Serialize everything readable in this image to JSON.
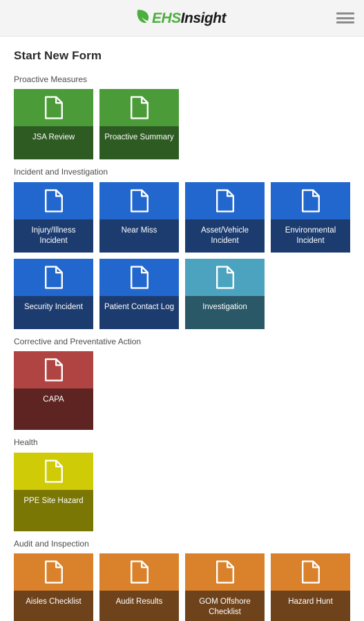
{
  "header": {
    "logo": {
      "leaf_icon": "leaf-icon",
      "brand_primary": "EHS",
      "brand_secondary": "Insight"
    },
    "menu_icon": "hamburger-menu-icon"
  },
  "page": {
    "title": "Start New Form"
  },
  "colors": {
    "header_bg": "#f4f4f4",
    "leaf_green": "#4cae3e",
    "green_light": "#4b9b38",
    "green_dark": "#2d5b22",
    "blue_light": "#2167ce",
    "blue_dark": "#1c3c70",
    "teal_light": "#4ba3bf",
    "teal_dark": "#2a5866",
    "red_light": "#b04442",
    "red_dark": "#5e2422",
    "yellow_light": "#cfcb07",
    "yellow_dark": "#7a7705",
    "orange_light": "#d9822b",
    "orange_dark": "#6e431c"
  },
  "sections": [
    {
      "label": "Proactive Measures",
      "rows": [
        [
          {
            "label": "JSA Review",
            "icon": "document-icon",
            "top_color": "#4b9b38",
            "bottom_color": "#2d5b22"
          },
          {
            "label": "Proactive Summary",
            "icon": "document-icon",
            "top_color": "#4b9b38",
            "bottom_color": "#2d5b22"
          }
        ]
      ]
    },
    {
      "label": "Incident and Investigation",
      "rows": [
        [
          {
            "label": "Injury/Illness Incident",
            "icon": "document-icon",
            "top_color": "#2167ce",
            "bottom_color": "#1c3c70"
          },
          {
            "label": "Near Miss",
            "icon": "document-icon",
            "top_color": "#2167ce",
            "bottom_color": "#1c3c70"
          },
          {
            "label": "Asset/Vehicle Incident",
            "icon": "document-icon",
            "top_color": "#2167ce",
            "bottom_color": "#1c3c70"
          },
          {
            "label": "Environmental Incident",
            "icon": "document-icon",
            "top_color": "#2167ce",
            "bottom_color": "#1c3c70"
          }
        ],
        [
          {
            "label": "Security Incident",
            "icon": "document-icon",
            "top_color": "#2167ce",
            "bottom_color": "#1c3c70"
          },
          {
            "label": "Patient Contact Log",
            "icon": "document-icon",
            "top_color": "#2167ce",
            "bottom_color": "#1c3c70"
          },
          {
            "label": "Investigation",
            "icon": "document-icon",
            "top_color": "#4ba3bf",
            "bottom_color": "#2a5866"
          }
        ]
      ]
    },
    {
      "label": "Corrective and Preventative Action",
      "rows": [
        [
          {
            "label": "CAPA",
            "icon": "document-icon",
            "top_color": "#b04442",
            "bottom_color": "#5e2422"
          }
        ]
      ]
    },
    {
      "label": "Health",
      "rows": [
        [
          {
            "label": "PPE Site Hazard",
            "icon": "document-icon",
            "top_color": "#cfcb07",
            "bottom_color": "#7a7705"
          }
        ]
      ]
    },
    {
      "label": "Audit and Inspection",
      "rows": [
        [
          {
            "label": "Aisles Checklist",
            "icon": "document-icon",
            "top_color": "#d9822b",
            "bottom_color": "#6e431c"
          },
          {
            "label": "Audit Results",
            "icon": "document-icon",
            "top_color": "#d9822b",
            "bottom_color": "#6e431c"
          },
          {
            "label": "GOM Offshore Checklist",
            "icon": "document-icon",
            "top_color": "#d9822b",
            "bottom_color": "#6e431c"
          },
          {
            "label": "Hazard Hunt",
            "icon": "document-icon",
            "top_color": "#d9822b",
            "bottom_color": "#6e431c"
          }
        ]
      ]
    }
  ]
}
